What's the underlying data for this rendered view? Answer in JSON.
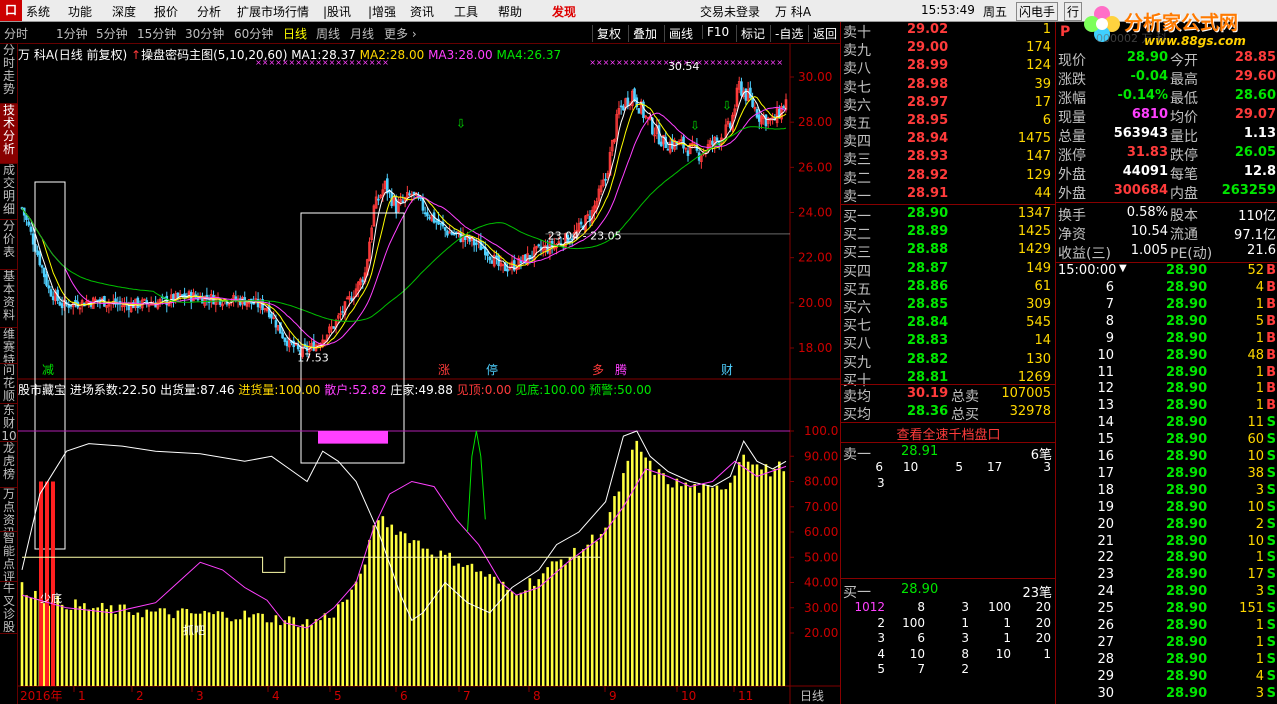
{
  "colors": {
    "up": "#ff3b3b",
    "down": "#00e600",
    "bg": "#000000",
    "grid": "#800000",
    "text": "#c0c0c0",
    "ma1": "#ffffff",
    "ma2": "#ffff00",
    "ma3": "#ff40ff",
    "ma4": "#00c000",
    "vol": "#ffff40"
  },
  "menu": {
    "logo": "口",
    "items": [
      "系统",
      "功能",
      "深度",
      "报价",
      "分析",
      "扩展市场行情",
      "|股讯",
      "|增强",
      "资讯",
      "工具",
      "帮助"
    ],
    "highlight": "发现",
    "login": "交易未登录",
    "stock_name": "万 科A",
    "time": "15:53:49",
    "weekday": "周五",
    "flash_btn": "闪电手",
    "trade_btn": "行"
  },
  "watermark": {
    "brand": "分析家公式网",
    "url": "www.88gs.com",
    "code_overlay": "000002 万 科"
  },
  "toolbar": {
    "periods": [
      "分时",
      "1分钟",
      "5分钟",
      "15分钟",
      "30分钟",
      "60分钟",
      "日线",
      "周线",
      "月线",
      "更多 ›"
    ],
    "active": "日线",
    "buttons": [
      "复权",
      "叠加",
      "画线",
      "F10",
      "标记",
      "-自选",
      "返回"
    ]
  },
  "leftnav": [
    "分时走势",
    "技术分析",
    "成交明细",
    "分价表",
    "基本资料",
    "维赛特",
    "问花顺",
    "东财10",
    "龙虎榜",
    "万点资讯",
    "智能点评",
    "牛叉诊股"
  ],
  "main_chart": {
    "title": "万 科A",
    "adj": "(日线 前复权)",
    "indicator_name": "操盘密码主图",
    "params": "(5,10,20,60)",
    "ma": [
      {
        "label": "MA1:",
        "value": "28.37"
      },
      {
        "label": "MA2:",
        "value": "28.00"
      },
      {
        "label": "MA3:",
        "value": "28.00"
      },
      {
        "label": "MA4:",
        "value": "26.37"
      }
    ],
    "y_ticks": [
      "30.00",
      "28.00",
      "26.00",
      "24.00",
      "22.00",
      "20.00",
      "18.00"
    ],
    "annotations": {
      "high": "30.54",
      "low": "17.53",
      "range": "23.04 - 23.05"
    },
    "markers": [
      "减",
      "涨",
      "停",
      "多",
      "腾",
      "财"
    ]
  },
  "sub_chart": {
    "name": "股市藏宝",
    "fields": [
      {
        "label": "进场系数:",
        "value": "22.50"
      },
      {
        "label": "出货量:",
        "value": "87.46"
      },
      {
        "label": "进货量:",
        "value": "100.00"
      },
      {
        "label": "散户:",
        "value": "52.82"
      },
      {
        "label": "庄家:",
        "value": "49.88"
      },
      {
        "label": "见顶:",
        "value": "0.00"
      },
      {
        "label": "见底:",
        "value": "100.00"
      },
      {
        "label": "预警:",
        "value": "50.00"
      }
    ],
    "y_ticks": [
      "100.0",
      "90.00",
      "80.00",
      "70.00",
      "60.00",
      "50.00",
      "40.00",
      "30.00",
      "20.00"
    ],
    "labels": [
      "少底",
      "抓吧"
    ]
  },
  "x_axis": {
    "year": "2016年",
    "months": [
      "1",
      "2",
      "3",
      "4",
      "5",
      "6",
      "7",
      "8",
      "9",
      "10",
      "11"
    ],
    "period_label": "日线"
  },
  "chart_data": {
    "type": "candlestick",
    "title": "万 科A",
    "price_ylim": [
      16.8,
      31.2
    ],
    "indicator_ylim": [
      10,
      105
    ],
    "note": "daily price series estimated from chart; last close 28.90"
  },
  "order_book": {
    "asks": [
      [
        "卖十",
        "29.02",
        "1"
      ],
      [
        "卖九",
        "29.00",
        "174"
      ],
      [
        "卖八",
        "28.99",
        "124"
      ],
      [
        "卖七",
        "28.98",
        "39"
      ],
      [
        "卖六",
        "28.97",
        "17"
      ],
      [
        "卖五",
        "28.95",
        "6"
      ],
      [
        "卖四",
        "28.94",
        "1475"
      ],
      [
        "卖三",
        "28.93",
        "147"
      ],
      [
        "卖二",
        "28.92",
        "129"
      ],
      [
        "卖一",
        "28.91",
        "44"
      ]
    ],
    "bids": [
      [
        "买一",
        "28.90",
        "1347"
      ],
      [
        "买二",
        "28.89",
        "1425"
      ],
      [
        "买三",
        "28.88",
        "1429"
      ],
      [
        "买四",
        "28.87",
        "149"
      ],
      [
        "买五",
        "28.86",
        "61"
      ],
      [
        "买六",
        "28.85",
        "309"
      ],
      [
        "买七",
        "28.84",
        "545"
      ],
      [
        "买八",
        "28.83",
        "14"
      ],
      [
        "买九",
        "28.82",
        "130"
      ],
      [
        "买十",
        "28.81",
        "1269"
      ]
    ],
    "avg": [
      [
        "卖均",
        "30.19",
        "总卖",
        "107005"
      ],
      [
        "买均",
        "28.36",
        "总买",
        "32978"
      ]
    ],
    "link": "查看全速千档盘口",
    "sell1": {
      "label": "卖一",
      "price": "28.91",
      "count": "6笔",
      "queue": [
        "6",
        "10",
        "5",
        "17",
        "3",
        "3"
      ]
    },
    "buy1": {
      "label": "买一",
      "price": "28.90",
      "count": "23笔",
      "queue": [
        [
          "1012",
          "8",
          "3",
          "100",
          "20"
        ],
        [
          "2",
          "100",
          "1",
          "1",
          "20"
        ],
        [
          "3",
          "6",
          "3",
          "1",
          "20"
        ],
        [
          "4",
          "10",
          "8",
          "10",
          "1"
        ],
        [
          "5",
          "7",
          "2"
        ]
      ]
    }
  },
  "quote": {
    "stats": [
      [
        "现价",
        "28.90",
        "今开",
        "28.85"
      ],
      [
        "涨跌",
        "-0.04",
        "最高",
        "29.60"
      ],
      [
        "涨幅",
        "-0.14%",
        "最低",
        "28.60"
      ],
      [
        "现量",
        "6810",
        "均价",
        "29.07"
      ],
      [
        "总量",
        "563943",
        "量比",
        "1.13"
      ],
      [
        "涨停",
        "31.83",
        "跌停",
        "26.05"
      ],
      [
        "外盘",
        "44091",
        "每笔",
        "12.8"
      ],
      [
        "外盘",
        "300684",
        "内盘",
        "263259"
      ]
    ],
    "fund": [
      [
        "换手",
        "0.58%",
        "股本",
        "110亿"
      ],
      [
        "净资",
        "10.54",
        "流通",
        "97.1亿"
      ],
      [
        "收益(三)",
        "1.005",
        "PE(动)",
        "21.6"
      ]
    ],
    "tick_header": [
      "15:00:00",
      "28.90",
      "52",
      "B"
    ],
    "ticks": [
      [
        "6",
        "28.90",
        "4",
        "B"
      ],
      [
        "7",
        "28.90",
        "1",
        "B"
      ],
      [
        "8",
        "28.90",
        "5",
        "B"
      ],
      [
        "9",
        "28.90",
        "1",
        "B"
      ],
      [
        "10",
        "28.90",
        "48",
        "B"
      ],
      [
        "11",
        "28.90",
        "1",
        "B"
      ],
      [
        "12",
        "28.90",
        "1",
        "B"
      ],
      [
        "13",
        "28.90",
        "1",
        "B"
      ],
      [
        "14",
        "28.90",
        "11",
        "S"
      ],
      [
        "15",
        "28.90",
        "60",
        "S"
      ],
      [
        "16",
        "28.90",
        "10",
        "S"
      ],
      [
        "17",
        "28.90",
        "38",
        "S"
      ],
      [
        "18",
        "28.90",
        "3",
        "S"
      ],
      [
        "19",
        "28.90",
        "10",
        "S"
      ],
      [
        "20",
        "28.90",
        "2",
        "S"
      ],
      [
        "21",
        "28.90",
        "10",
        "S"
      ],
      [
        "22",
        "28.90",
        "1",
        "S"
      ],
      [
        "23",
        "28.90",
        "17",
        "S"
      ],
      [
        "24",
        "28.90",
        "3",
        "S"
      ],
      [
        "25",
        "28.90",
        "151",
        "S"
      ],
      [
        "26",
        "28.90",
        "1",
        "S"
      ],
      [
        "27",
        "28.90",
        "1",
        "S"
      ],
      [
        "28",
        "28.90",
        "1",
        "S"
      ],
      [
        "29",
        "28.90",
        "4",
        "S"
      ],
      [
        "30",
        "28.90",
        "3",
        "S"
      ]
    ]
  }
}
